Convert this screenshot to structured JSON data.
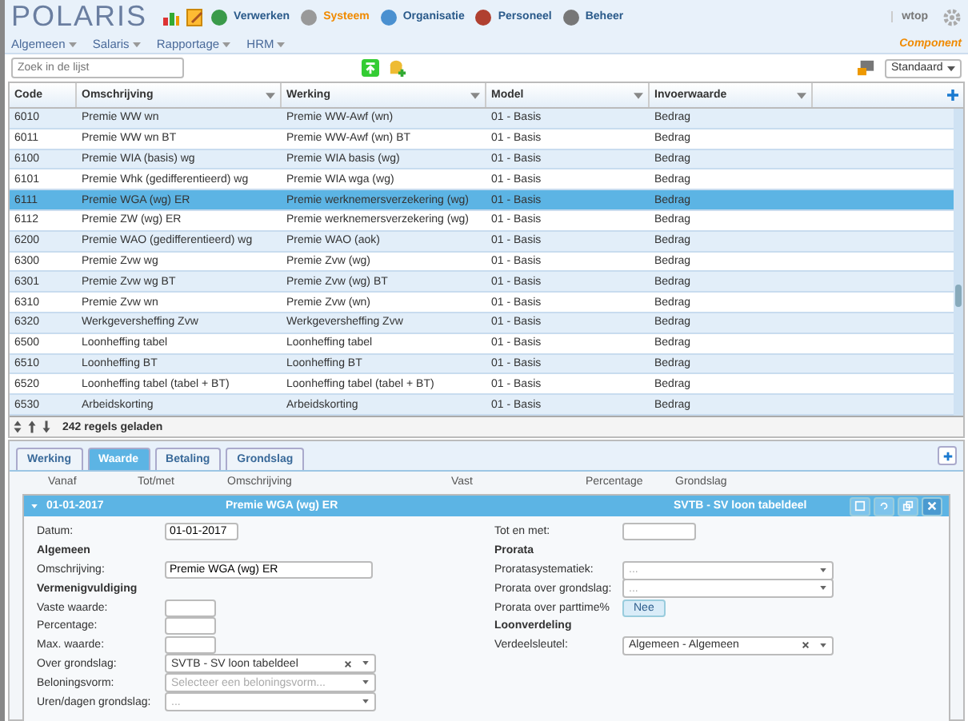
{
  "header": {
    "logo": "POLARIS",
    "nav": [
      {
        "label": "Verwerken",
        "selected": false
      },
      {
        "label": "Systeem",
        "selected": true
      },
      {
        "label": "Organisatie",
        "selected": false
      },
      {
        "label": "Personeel",
        "selected": false
      },
      {
        "label": "Beheer",
        "selected": false
      }
    ],
    "user": "wtop"
  },
  "menu": [
    "Algemeen",
    "Salaris",
    "Rapportage",
    "HRM"
  ],
  "context": "Component",
  "search": {
    "placeholder": "Zoek in de lijst"
  },
  "view": "Standaard",
  "table": {
    "columns": [
      "Code",
      "Omschrijving",
      "Werking",
      "Model",
      "Invoerwaarde"
    ],
    "rows": [
      {
        "cells": [
          "6010",
          "Premie WW wn",
          "Premie WW-Awf (wn)",
          "01 - Basis",
          "Bedrag"
        ],
        "selected": false
      },
      {
        "cells": [
          "6011",
          "Premie WW wn BT",
          "Premie WW-Awf (wn) BT",
          "01 - Basis",
          "Bedrag"
        ],
        "selected": false
      },
      {
        "cells": [
          "6100",
          "Premie WIA (basis) wg",
          "Premie WIA basis (wg)",
          "01 - Basis",
          "Bedrag"
        ],
        "selected": false
      },
      {
        "cells": [
          "6101",
          "Premie Whk (gedifferentieerd) wg",
          "Premie WIA wga (wg)",
          "01 - Basis",
          "Bedrag"
        ],
        "selected": false
      },
      {
        "cells": [
          "6111",
          "Premie WGA (wg) ER",
          "Premie werknemersverzekering (wg)",
          "01 - Basis",
          "Bedrag"
        ],
        "selected": true
      },
      {
        "cells": [
          "6112",
          "Premie ZW (wg) ER",
          "Premie werknemersverzekering (wg)",
          "01 - Basis",
          "Bedrag"
        ],
        "selected": false
      },
      {
        "cells": [
          "6200",
          "Premie WAO (gedifferentieerd) wg",
          "Premie WAO (aok)",
          "01 - Basis",
          "Bedrag"
        ],
        "selected": false
      },
      {
        "cells": [
          "6300",
          "Premie Zvw wg",
          "Premie Zvw (wg)",
          "01 - Basis",
          "Bedrag"
        ],
        "selected": false
      },
      {
        "cells": [
          "6301",
          "Premie Zvw wg BT",
          "Premie Zvw (wg) BT",
          "01 - Basis",
          "Bedrag"
        ],
        "selected": false
      },
      {
        "cells": [
          "6310",
          "Premie Zvw wn",
          "Premie Zvw (wn)",
          "01 - Basis",
          "Bedrag"
        ],
        "selected": false
      },
      {
        "cells": [
          "6320",
          "Werkgeversheffing Zvw",
          "Werkgeversheffing Zvw",
          "01 - Basis",
          "Bedrag"
        ],
        "selected": false
      },
      {
        "cells": [
          "6500",
          "Loonheffing tabel",
          "Loonheffing tabel",
          "01 - Basis",
          "Bedrag"
        ],
        "selected": false
      },
      {
        "cells": [
          "6510",
          "Loonheffing BT",
          "Loonheffing BT",
          "01 - Basis",
          "Bedrag"
        ],
        "selected": false
      },
      {
        "cells": [
          "6520",
          "Loonheffing tabel (tabel + BT)",
          "Loonheffing tabel (tabel + BT)",
          "01 - Basis",
          "Bedrag"
        ],
        "selected": false
      },
      {
        "cells": [
          "6530",
          "Arbeidskorting",
          "Arbeidskorting",
          "01 - Basis",
          "Bedrag"
        ],
        "selected": false
      }
    ],
    "status": "242 regels geladen"
  },
  "tabs": [
    {
      "label": "Werking",
      "selected": false
    },
    {
      "label": "Waarde",
      "selected": true
    },
    {
      "label": "Betaling",
      "selected": false
    },
    {
      "label": "Grondslag",
      "selected": false
    }
  ],
  "sub_columns": [
    "Vanaf",
    "Tot/met",
    "Omschrijving",
    "Vast",
    "Percentage",
    "Grondslag"
  ],
  "detail": {
    "date": "01-01-2017",
    "title": "Premie WGA (wg) ER",
    "basis": "SVTB - SV loon tabeldeel"
  },
  "form_left": [
    {
      "kind": "date",
      "label": "Datum:",
      "value": "01-01-2017"
    },
    {
      "kind": "heading",
      "label": "Algemeen"
    },
    {
      "kind": "text",
      "label": "Omschrijving:",
      "value": "Premie WGA (wg) ER"
    },
    {
      "kind": "heading",
      "label": "Vermenigvuldiging"
    },
    {
      "kind": "number",
      "label": "Vaste waarde:"
    },
    {
      "kind": "number",
      "label": "Percentage:"
    },
    {
      "kind": "number",
      "label": "Max. waarde:"
    },
    {
      "kind": "select",
      "label": "Over grondslag:",
      "value": "SVTB - SV loon tabeldeel",
      "clearable": true
    },
    {
      "kind": "select",
      "label": "Beloningsvorm:",
      "placeholder": "Selecteer een beloningsvorm...",
      "clearable": false
    },
    {
      "kind": "select",
      "label": "Uren/dagen grondslag:",
      "placeholder": "...",
      "clearable": false
    }
  ],
  "form_right": [
    {
      "kind": "date",
      "label": "Tot en met:"
    },
    {
      "kind": "heading",
      "label": "Prorata"
    },
    {
      "kind": "select",
      "label": "Proratasystematiek:",
      "placeholder": "...",
      "clearable": false
    },
    {
      "kind": "select",
      "label": "Prorata over grondslag:",
      "placeholder": "...",
      "clearable": false
    },
    {
      "kind": "toggle",
      "label": "Prorata over parttime%",
      "value": "Nee"
    },
    {
      "kind": "heading",
      "label": "Loonverdeling"
    },
    {
      "kind": "select",
      "label": "Verdeelsleutel:",
      "value": "Algemeen - Algemeen",
      "clearable": true
    }
  ]
}
